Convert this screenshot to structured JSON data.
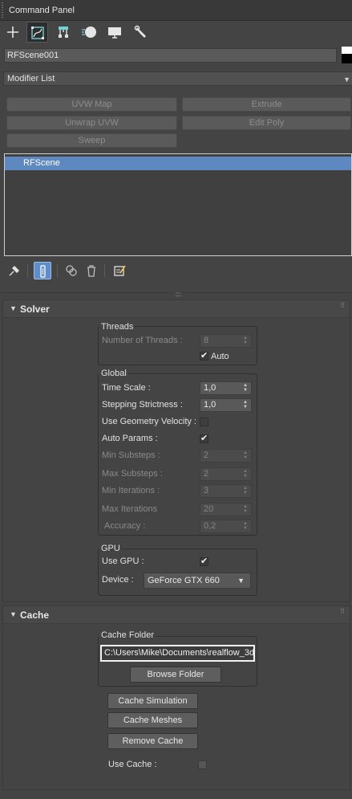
{
  "window": {
    "title": "Command Panel"
  },
  "tabs": [
    {
      "icon": "create-plus-icon"
    },
    {
      "icon": "modify-icon"
    },
    {
      "icon": "hierarchy-icon"
    },
    {
      "icon": "motion-icon"
    },
    {
      "icon": "display-icon"
    },
    {
      "icon": "utilities-wrench-icon"
    }
  ],
  "object": {
    "name": "RFScene001",
    "color": "#000000"
  },
  "modifier_list": {
    "label": "Modifier List"
  },
  "modifier_buttons": [
    "UVW Map",
    "Extrude",
    "Unwrap UVW",
    "Edit Poly",
    "Sweep"
  ],
  "stack": {
    "items": [
      "RFScene"
    ],
    "selected_color": "#5e88c0"
  },
  "stack_tools": [
    "pin-stack-icon",
    "show-end-result-icon",
    "make-unique-icon",
    "remove-modifier-icon",
    "configure-modifier-sets-icon"
  ],
  "solver": {
    "title": "Solver",
    "threads": {
      "title": "Threads",
      "num_threads_label": "Number of Threads :",
      "num_threads_value": "8",
      "auto_label": "Auto",
      "auto_checked": true
    },
    "global": {
      "title": "Global",
      "time_scale_label": "Time Scale :",
      "time_scale_value": "1,0",
      "stepping_label": "Stepping Strictness :",
      "stepping_value": "1,0",
      "use_geom_vel_label": "Use Geometry Velocity :",
      "use_geom_vel_checked": false,
      "auto_params_label": "Auto Params :",
      "auto_params_checked": true,
      "min_substeps_label": "Min Substeps :",
      "min_substeps_value": "2",
      "max_substeps_label": "Max Substeps :",
      "max_substeps_value": "2",
      "min_iterations_label": "Min Iterations :",
      "min_iterations_value": "3",
      "max_iterations_label": "Max Iterations",
      "max_iterations_value": "20",
      "accuracy_label": "Accuracy :",
      "accuracy_value": "0,2"
    },
    "gpu": {
      "title": "GPU",
      "use_gpu_label": "Use GPU :",
      "use_gpu_checked": true,
      "device_label": "Device :",
      "device_value": "GeForce GTX 660"
    }
  },
  "cache": {
    "title": "Cache",
    "folder_group_title": "Cache Folder",
    "folder_path": "C:\\Users\\Mike\\Documents\\realflow_3d",
    "browse_label": "Browse Folder",
    "cache_simulation_label": "Cache Simulation",
    "cache_meshes_label": "Cache Meshes",
    "remove_cache_label": "Remove Cache",
    "use_cache_label": "Use Cache :",
    "use_cache_checked": false
  }
}
